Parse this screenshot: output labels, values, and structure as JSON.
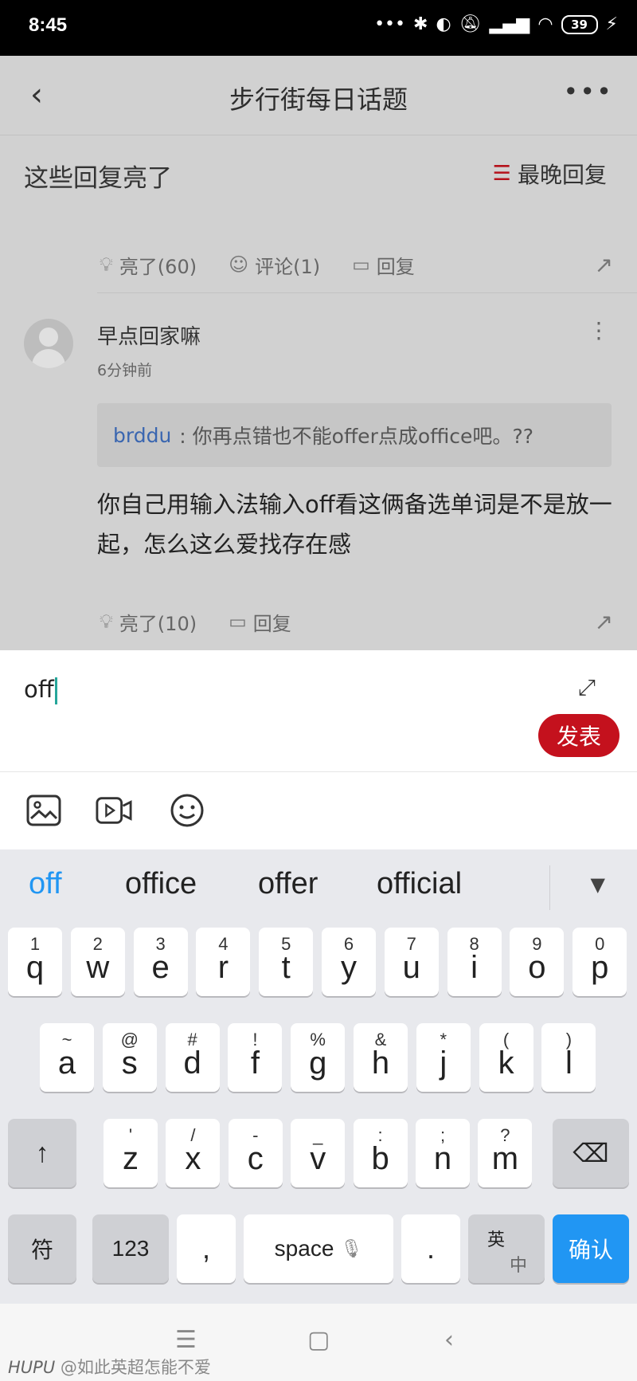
{
  "status_bar": {
    "time": "8:45",
    "battery": "39"
  },
  "header": {
    "title": "步行街每日话题"
  },
  "section": {
    "title": "这些回复亮了",
    "sort_label": "最晚回复"
  },
  "post_actions_a": {
    "like": "亮了(60)",
    "comment": "评论(1)",
    "reply": "回复"
  },
  "comment": {
    "username": "早点回家嘛",
    "timestamp": "6分钟前",
    "quote_user": "brddu",
    "quote_text": ": 你再点错也不能offer点成office吧。??",
    "body": "你自己用输入法输入off看这俩备选单词是不是放一起，怎么这么爱找存在感"
  },
  "post_actions_b": {
    "like": "亮了(10)",
    "reply": "回复"
  },
  "reply_box": {
    "value": "off",
    "post_label": "发表"
  },
  "keyboard": {
    "suggestions": [
      "off",
      "office",
      "offer",
      "official"
    ],
    "row1": [
      {
        "sub": "1",
        "main": "q"
      },
      {
        "sub": "2",
        "main": "w"
      },
      {
        "sub": "3",
        "main": "e"
      },
      {
        "sub": "4",
        "main": "r"
      },
      {
        "sub": "5",
        "main": "t"
      },
      {
        "sub": "6",
        "main": "y"
      },
      {
        "sub": "7",
        "main": "u"
      },
      {
        "sub": "8",
        "main": "i"
      },
      {
        "sub": "9",
        "main": "o"
      },
      {
        "sub": "0",
        "main": "p"
      }
    ],
    "row2": [
      {
        "sub": "~",
        "main": "a"
      },
      {
        "sub": "@",
        "main": "s"
      },
      {
        "sub": "#",
        "main": "d"
      },
      {
        "sub": "!",
        "main": "f"
      },
      {
        "sub": "%",
        "main": "g"
      },
      {
        "sub": "&",
        "main": "h"
      },
      {
        "sub": "*",
        "main": "j"
      },
      {
        "sub": "(",
        "main": "k"
      },
      {
        "sub": ")",
        "main": "l"
      }
    ],
    "row3": [
      {
        "sub": "'",
        "main": "z"
      },
      {
        "sub": "/",
        "main": "x"
      },
      {
        "sub": "-",
        "main": "c"
      },
      {
        "sub": "_",
        "main": "v"
      },
      {
        "sub": ":",
        "main": "b"
      },
      {
        "sub": ";",
        "main": "n"
      },
      {
        "sub": "?",
        "main": "m"
      }
    ],
    "symbols_label": "符",
    "numbers_label": "123",
    "comma_label": ",",
    "space_label": "space",
    "period_label": ".",
    "lang_top": "英",
    "lang_bottom": "中",
    "confirm_label": "确认"
  },
  "watermark": {
    "brand": "HUPU",
    "text": "@如此英超怎能不爱"
  }
}
